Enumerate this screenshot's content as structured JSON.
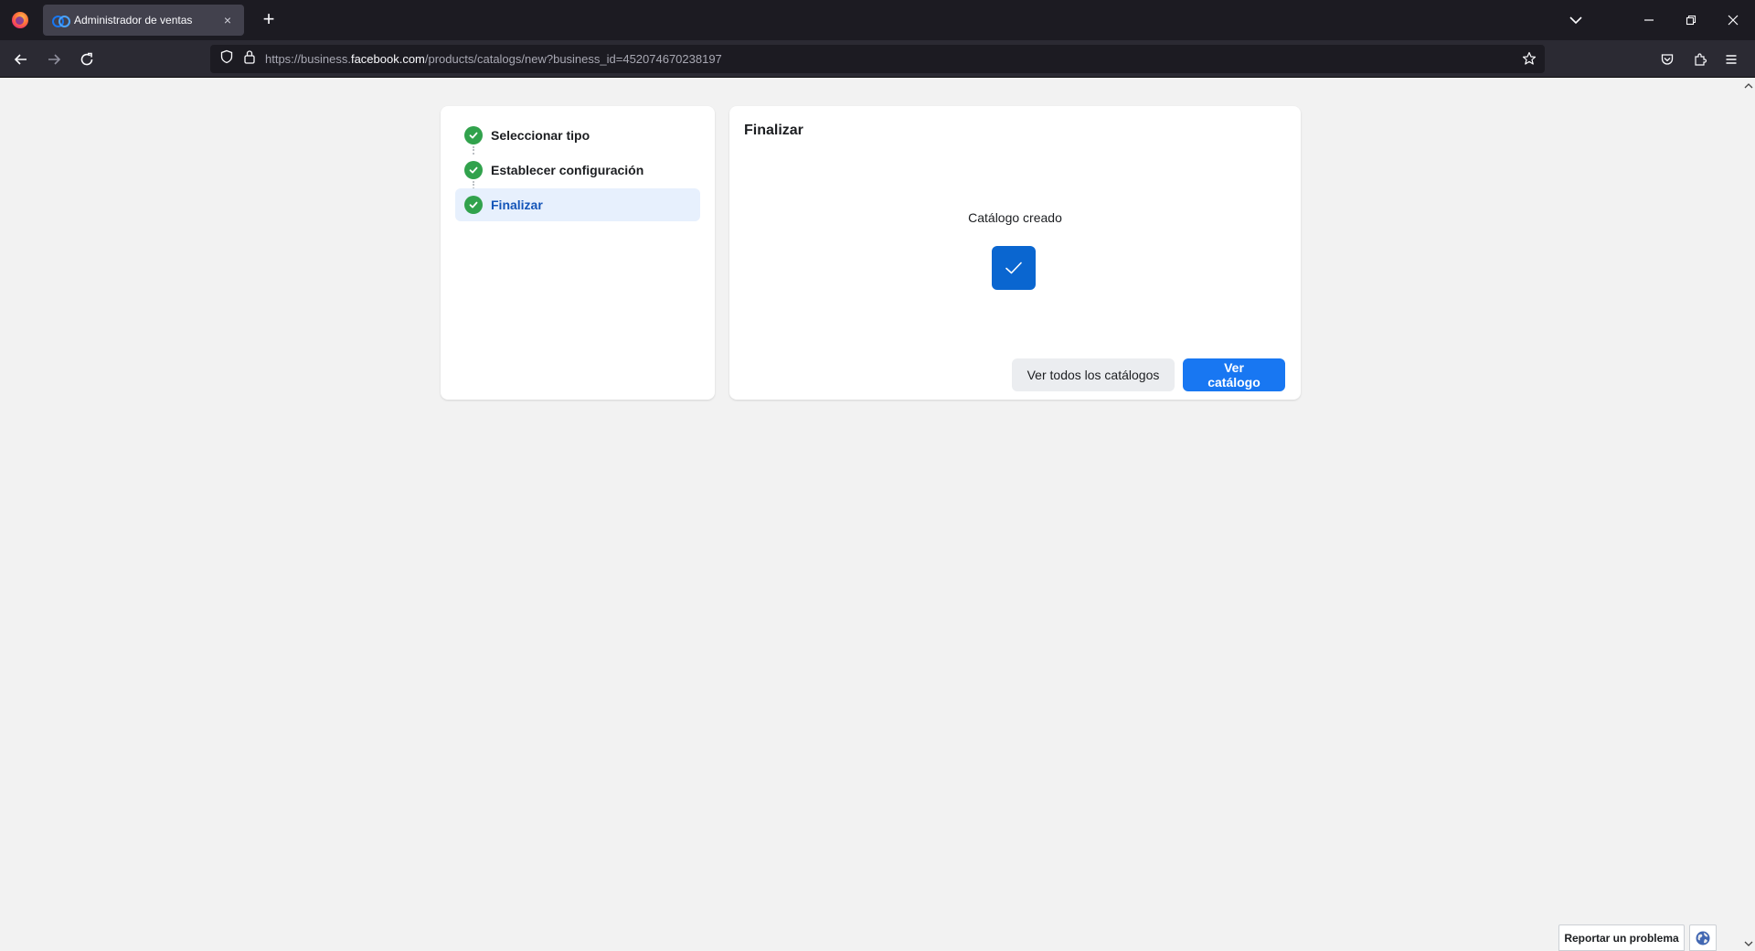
{
  "browser": {
    "tab_title": "Administrador de ventas",
    "tab_close": "×",
    "new_tab": "+",
    "url_prefix": "https://business.",
    "url_domain": "facebook.com",
    "url_suffix": "/products/catalogs/new?business_id=452074670238197"
  },
  "steps": [
    {
      "label": "Seleccionar tipo",
      "state": "done"
    },
    {
      "label": "Establecer configuración",
      "state": "done"
    },
    {
      "label": "Finalizar",
      "state": "active"
    }
  ],
  "main": {
    "title": "Finalizar",
    "success_label": "Catálogo creado",
    "secondary_button": "Ver todos los catálogos",
    "primary_button": "Ver catálogo"
  },
  "footer": {
    "report_button": "Reportar un problema"
  },
  "colors": {
    "primary": "#1877f2",
    "success_badge": "#0a66d0",
    "step_check": "#31a24c",
    "active_step_bg": "#e7f0fd"
  }
}
